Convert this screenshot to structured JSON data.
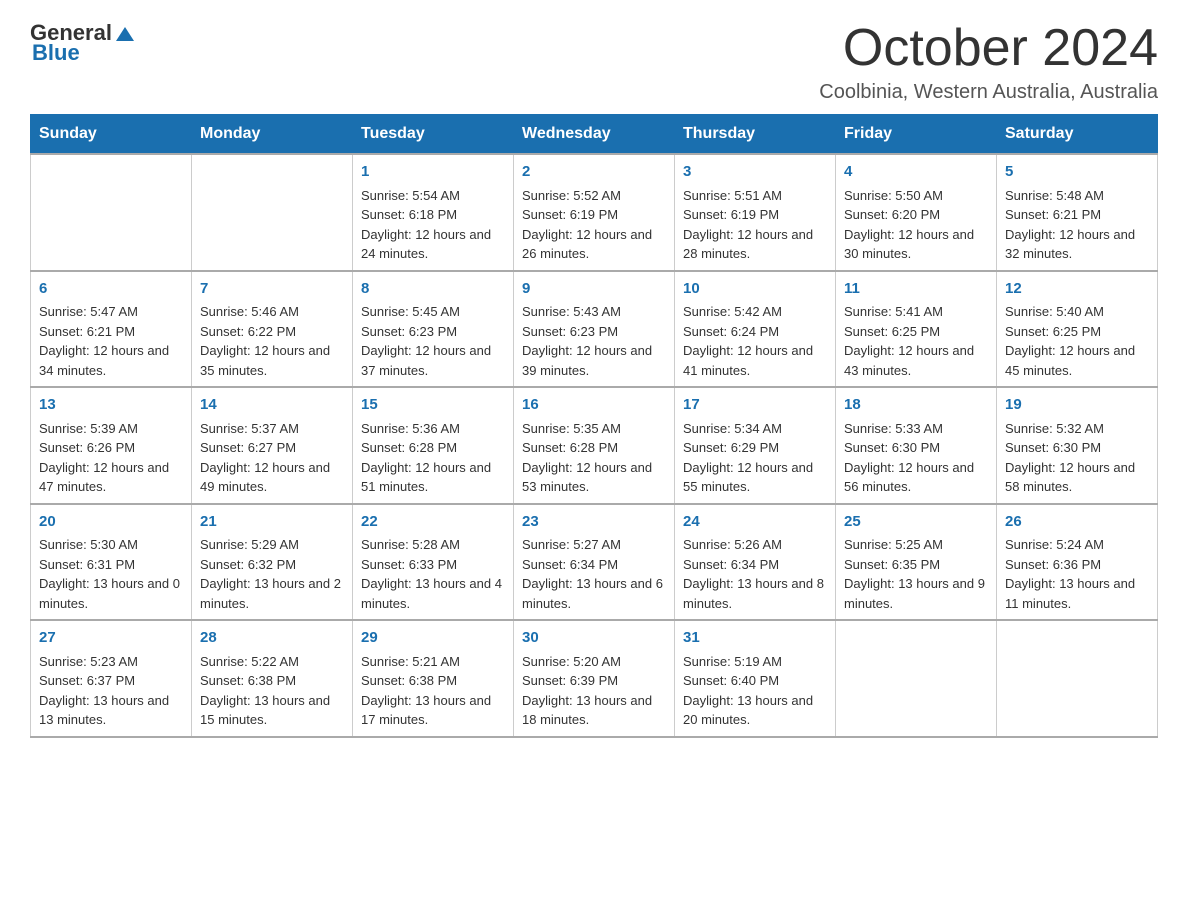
{
  "header": {
    "logo": {
      "general": "General",
      "blue": "Blue"
    },
    "title": "October 2024",
    "subtitle": "Coolbinia, Western Australia, Australia"
  },
  "days_of_week": [
    "Sunday",
    "Monday",
    "Tuesday",
    "Wednesday",
    "Thursday",
    "Friday",
    "Saturday"
  ],
  "weeks": [
    [
      {
        "day": "",
        "sunrise": "",
        "sunset": "",
        "daylight": ""
      },
      {
        "day": "",
        "sunrise": "",
        "sunset": "",
        "daylight": ""
      },
      {
        "day": "1",
        "sunrise": "Sunrise: 5:54 AM",
        "sunset": "Sunset: 6:18 PM",
        "daylight": "Daylight: 12 hours and 24 minutes."
      },
      {
        "day": "2",
        "sunrise": "Sunrise: 5:52 AM",
        "sunset": "Sunset: 6:19 PM",
        "daylight": "Daylight: 12 hours and 26 minutes."
      },
      {
        "day": "3",
        "sunrise": "Sunrise: 5:51 AM",
        "sunset": "Sunset: 6:19 PM",
        "daylight": "Daylight: 12 hours and 28 minutes."
      },
      {
        "day": "4",
        "sunrise": "Sunrise: 5:50 AM",
        "sunset": "Sunset: 6:20 PM",
        "daylight": "Daylight: 12 hours and 30 minutes."
      },
      {
        "day": "5",
        "sunrise": "Sunrise: 5:48 AM",
        "sunset": "Sunset: 6:21 PM",
        "daylight": "Daylight: 12 hours and 32 minutes."
      }
    ],
    [
      {
        "day": "6",
        "sunrise": "Sunrise: 5:47 AM",
        "sunset": "Sunset: 6:21 PM",
        "daylight": "Daylight: 12 hours and 34 minutes."
      },
      {
        "day": "7",
        "sunrise": "Sunrise: 5:46 AM",
        "sunset": "Sunset: 6:22 PM",
        "daylight": "Daylight: 12 hours and 35 minutes."
      },
      {
        "day": "8",
        "sunrise": "Sunrise: 5:45 AM",
        "sunset": "Sunset: 6:23 PM",
        "daylight": "Daylight: 12 hours and 37 minutes."
      },
      {
        "day": "9",
        "sunrise": "Sunrise: 5:43 AM",
        "sunset": "Sunset: 6:23 PM",
        "daylight": "Daylight: 12 hours and 39 minutes."
      },
      {
        "day": "10",
        "sunrise": "Sunrise: 5:42 AM",
        "sunset": "Sunset: 6:24 PM",
        "daylight": "Daylight: 12 hours and 41 minutes."
      },
      {
        "day": "11",
        "sunrise": "Sunrise: 5:41 AM",
        "sunset": "Sunset: 6:25 PM",
        "daylight": "Daylight: 12 hours and 43 minutes."
      },
      {
        "day": "12",
        "sunrise": "Sunrise: 5:40 AM",
        "sunset": "Sunset: 6:25 PM",
        "daylight": "Daylight: 12 hours and 45 minutes."
      }
    ],
    [
      {
        "day": "13",
        "sunrise": "Sunrise: 5:39 AM",
        "sunset": "Sunset: 6:26 PM",
        "daylight": "Daylight: 12 hours and 47 minutes."
      },
      {
        "day": "14",
        "sunrise": "Sunrise: 5:37 AM",
        "sunset": "Sunset: 6:27 PM",
        "daylight": "Daylight: 12 hours and 49 minutes."
      },
      {
        "day": "15",
        "sunrise": "Sunrise: 5:36 AM",
        "sunset": "Sunset: 6:28 PM",
        "daylight": "Daylight: 12 hours and 51 minutes."
      },
      {
        "day": "16",
        "sunrise": "Sunrise: 5:35 AM",
        "sunset": "Sunset: 6:28 PM",
        "daylight": "Daylight: 12 hours and 53 minutes."
      },
      {
        "day": "17",
        "sunrise": "Sunrise: 5:34 AM",
        "sunset": "Sunset: 6:29 PM",
        "daylight": "Daylight: 12 hours and 55 minutes."
      },
      {
        "day": "18",
        "sunrise": "Sunrise: 5:33 AM",
        "sunset": "Sunset: 6:30 PM",
        "daylight": "Daylight: 12 hours and 56 minutes."
      },
      {
        "day": "19",
        "sunrise": "Sunrise: 5:32 AM",
        "sunset": "Sunset: 6:30 PM",
        "daylight": "Daylight: 12 hours and 58 minutes."
      }
    ],
    [
      {
        "day": "20",
        "sunrise": "Sunrise: 5:30 AM",
        "sunset": "Sunset: 6:31 PM",
        "daylight": "Daylight: 13 hours and 0 minutes."
      },
      {
        "day": "21",
        "sunrise": "Sunrise: 5:29 AM",
        "sunset": "Sunset: 6:32 PM",
        "daylight": "Daylight: 13 hours and 2 minutes."
      },
      {
        "day": "22",
        "sunrise": "Sunrise: 5:28 AM",
        "sunset": "Sunset: 6:33 PM",
        "daylight": "Daylight: 13 hours and 4 minutes."
      },
      {
        "day": "23",
        "sunrise": "Sunrise: 5:27 AM",
        "sunset": "Sunset: 6:34 PM",
        "daylight": "Daylight: 13 hours and 6 minutes."
      },
      {
        "day": "24",
        "sunrise": "Sunrise: 5:26 AM",
        "sunset": "Sunset: 6:34 PM",
        "daylight": "Daylight: 13 hours and 8 minutes."
      },
      {
        "day": "25",
        "sunrise": "Sunrise: 5:25 AM",
        "sunset": "Sunset: 6:35 PM",
        "daylight": "Daylight: 13 hours and 9 minutes."
      },
      {
        "day": "26",
        "sunrise": "Sunrise: 5:24 AM",
        "sunset": "Sunset: 6:36 PM",
        "daylight": "Daylight: 13 hours and 11 minutes."
      }
    ],
    [
      {
        "day": "27",
        "sunrise": "Sunrise: 5:23 AM",
        "sunset": "Sunset: 6:37 PM",
        "daylight": "Daylight: 13 hours and 13 minutes."
      },
      {
        "day": "28",
        "sunrise": "Sunrise: 5:22 AM",
        "sunset": "Sunset: 6:38 PM",
        "daylight": "Daylight: 13 hours and 15 minutes."
      },
      {
        "day": "29",
        "sunrise": "Sunrise: 5:21 AM",
        "sunset": "Sunset: 6:38 PM",
        "daylight": "Daylight: 13 hours and 17 minutes."
      },
      {
        "day": "30",
        "sunrise": "Sunrise: 5:20 AM",
        "sunset": "Sunset: 6:39 PM",
        "daylight": "Daylight: 13 hours and 18 minutes."
      },
      {
        "day": "31",
        "sunrise": "Sunrise: 5:19 AM",
        "sunset": "Sunset: 6:40 PM",
        "daylight": "Daylight: 13 hours and 20 minutes."
      },
      {
        "day": "",
        "sunrise": "",
        "sunset": "",
        "daylight": ""
      },
      {
        "day": "",
        "sunrise": "",
        "sunset": "",
        "daylight": ""
      }
    ]
  ]
}
